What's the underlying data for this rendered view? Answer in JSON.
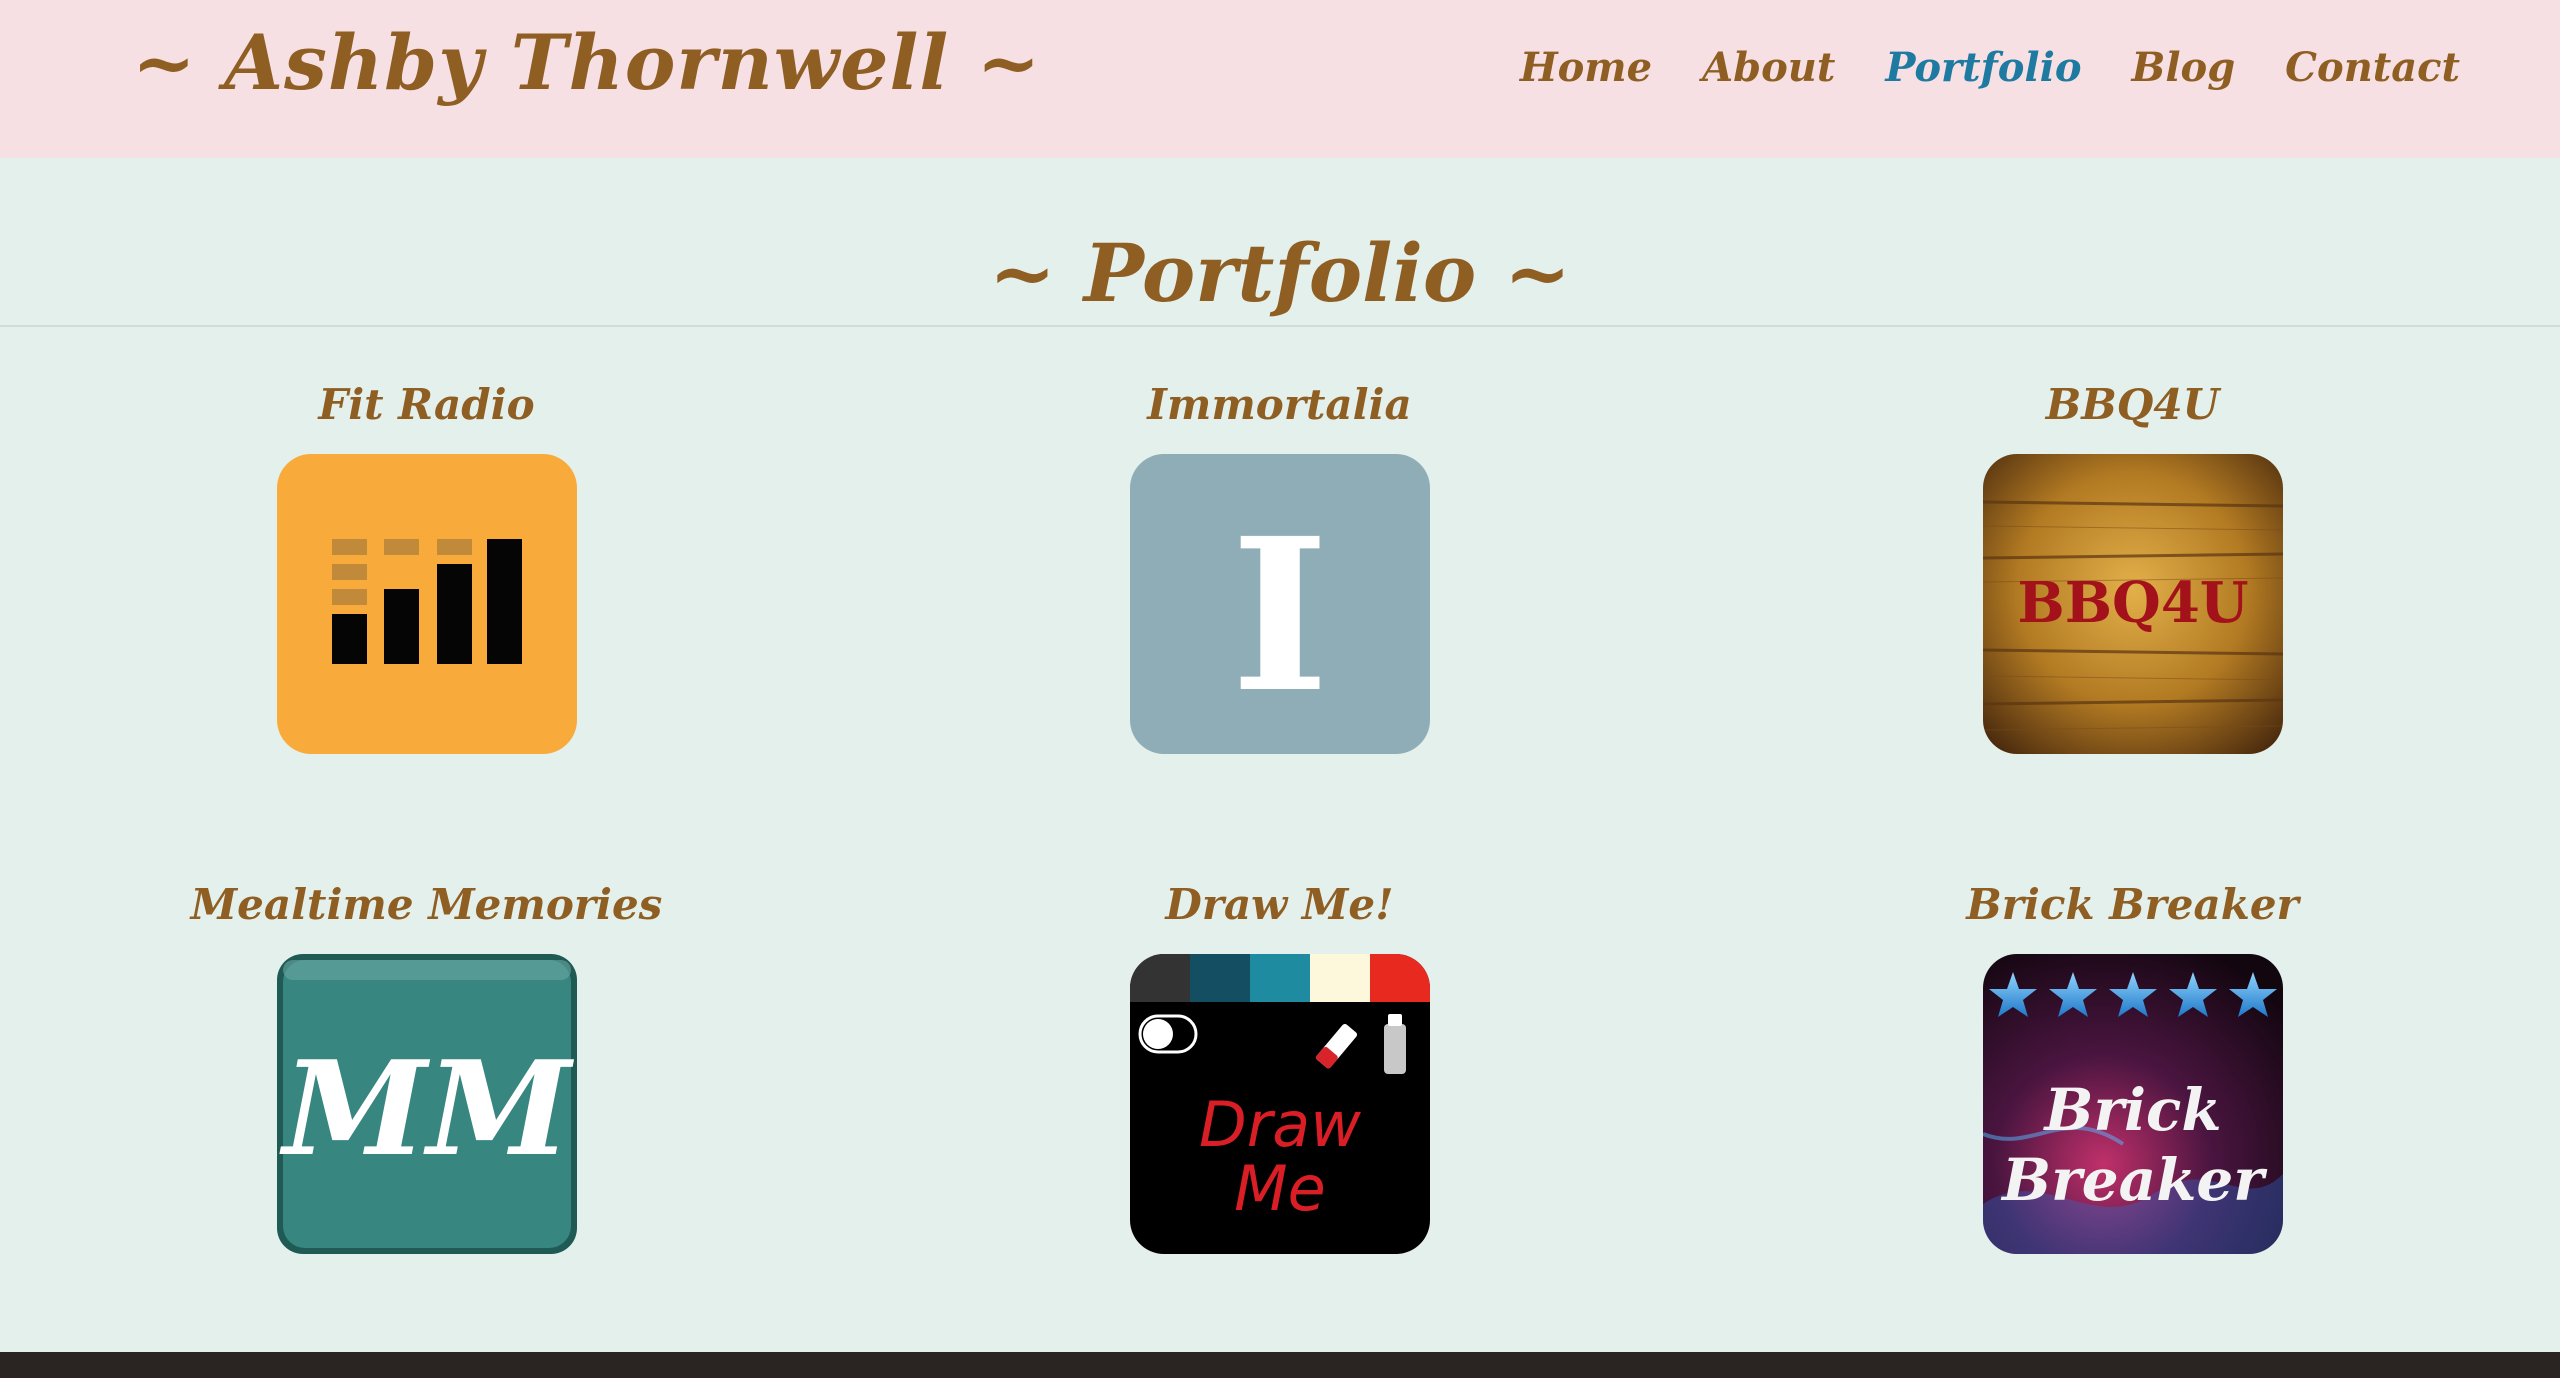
{
  "header": {
    "site_title": "~ Ashby Thornwell ~",
    "nav": [
      {
        "label": "Home",
        "active": false
      },
      {
        "label": "About",
        "active": false
      },
      {
        "label": "Portfolio",
        "active": true
      },
      {
        "label": "Blog",
        "active": false
      },
      {
        "label": "Contact",
        "active": false
      }
    ]
  },
  "main": {
    "heading": "~ Portfolio ~",
    "projects": [
      {
        "title": "Fit Radio",
        "icon": "fit-radio-app-icon"
      },
      {
        "title": "Immortalia",
        "icon": "immortalia-app-icon",
        "icon_text": "I"
      },
      {
        "title": "BBQ4U",
        "icon": "bbq4u-app-icon",
        "icon_text": "BBQ4U"
      },
      {
        "title": "Mealtime Memories",
        "icon": "mealtime-memories-app-icon",
        "icon_text": "MM"
      },
      {
        "title": "Draw Me!",
        "icon": "draw-me-app-icon",
        "icon_text_line1": "Draw",
        "icon_text_line2": "Me"
      },
      {
        "title": "Brick Breaker",
        "icon": "brick-breaker-app-icon",
        "icon_text_line1": "Brick",
        "icon_text_line2": "Breaker"
      }
    ]
  },
  "colors": {
    "header_bg": "#f6e0e4",
    "page_bg": "#e4f0ec",
    "text_brown": "#8f5e22",
    "nav_active": "#1e7aa0"
  }
}
